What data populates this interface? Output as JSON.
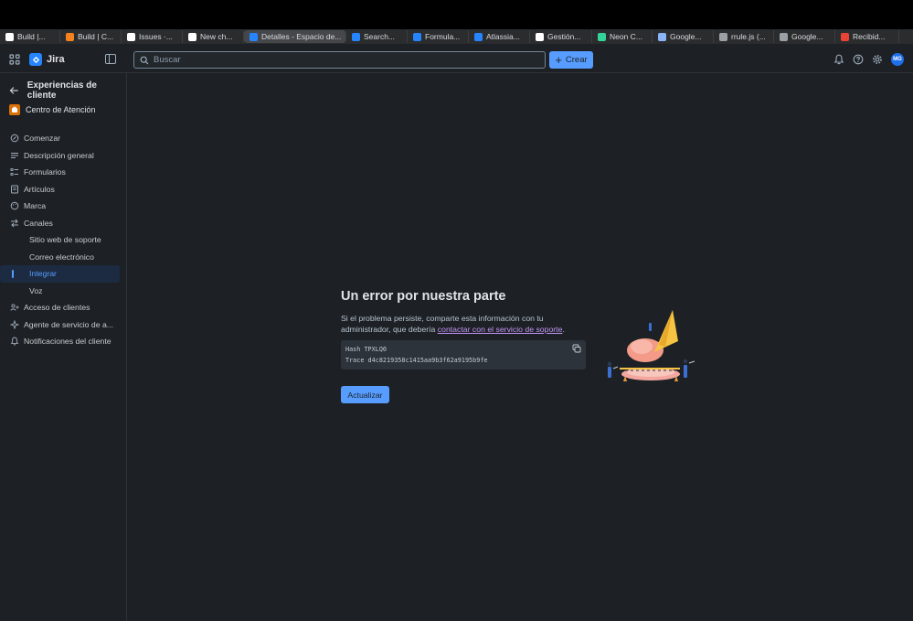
{
  "browser": {
    "tabs": [
      {
        "label": "Build |...",
        "icon": "build-icon",
        "color": "#ffffff"
      },
      {
        "label": "Build | C...",
        "icon": "cloud-icon",
        "color": "#f6821f"
      },
      {
        "label": "Issues ·...",
        "icon": "github-icon",
        "color": "#ffffff"
      },
      {
        "label": "New ch...",
        "icon": "github-icon",
        "color": "#ffffff"
      },
      {
        "label": "Detalles - Espacio de...",
        "icon": "jira-icon",
        "color": "#2684ff"
      },
      {
        "label": "Search...",
        "icon": "atlassian-icon",
        "color": "#2684ff"
      },
      {
        "label": "Formula...",
        "icon": "jira-icon",
        "color": "#2684ff"
      },
      {
        "label": "Atlassia...",
        "icon": "atlassian-icon",
        "color": "#2684ff"
      },
      {
        "label": "Gestión...",
        "icon": "openai-icon",
        "color": "#ffffff"
      },
      {
        "label": "Neon C...",
        "icon": "neon-icon",
        "color": "#34d399"
      },
      {
        "label": "Google...",
        "icon": "gemini-icon",
        "color": "#8ab4f8"
      },
      {
        "label": "rrule.js (...",
        "icon": "g-icon",
        "color": "#9aa0a6"
      },
      {
        "label": "Google...",
        "icon": "g-icon",
        "color": "#9aa0a6"
      },
      {
        "label": "Recibid...",
        "icon": "gmail-icon",
        "color": "#ea4335"
      }
    ]
  },
  "topnav": {
    "product": "Jira",
    "search_placeholder": "Buscar",
    "create_label": "Crear",
    "avatar_initials": "MG"
  },
  "sidebar": {
    "back_title": "Experiencias de cliente",
    "project_name": "Centro de Atención",
    "items": [
      {
        "label": "Comenzar",
        "icon": "rocket-icon"
      },
      {
        "label": "Descripción general",
        "icon": "list-icon"
      },
      {
        "label": "Formularios",
        "icon": "form-icon"
      },
      {
        "label": "Artículos",
        "icon": "document-icon"
      },
      {
        "label": "Marca",
        "icon": "palette-icon"
      },
      {
        "label": "Canales",
        "icon": "channels-icon"
      }
    ],
    "channel_items": [
      {
        "label": "Sitio web de soporte"
      },
      {
        "label": "Correo electrónico"
      },
      {
        "label": "Integrar",
        "selected": true
      },
      {
        "label": "Voz"
      }
    ],
    "bottom_items": [
      {
        "label": "Acceso de clientes",
        "icon": "people-icon"
      },
      {
        "label": "Agente de servicio de a...",
        "icon": "agent-icon"
      },
      {
        "label": "Notificaciones del cliente",
        "icon": "bell-icon"
      }
    ]
  },
  "error": {
    "title": "Un error por nuestra parte",
    "desc_prefix": "Si el problema persiste, comparte esta información con tu administrador, que debería ",
    "desc_link": "contactar con el servicio de soporte",
    "desc_suffix": ".",
    "hash_line": "Hash TPXLQ0",
    "trace_line": "Trace d4c8219358c1415aa9b3f62a9195b9fe",
    "refresh_label": "Actualizar"
  },
  "colors": {
    "accent": "#579dff",
    "background": "#1d2125",
    "link": "#c195f5"
  }
}
